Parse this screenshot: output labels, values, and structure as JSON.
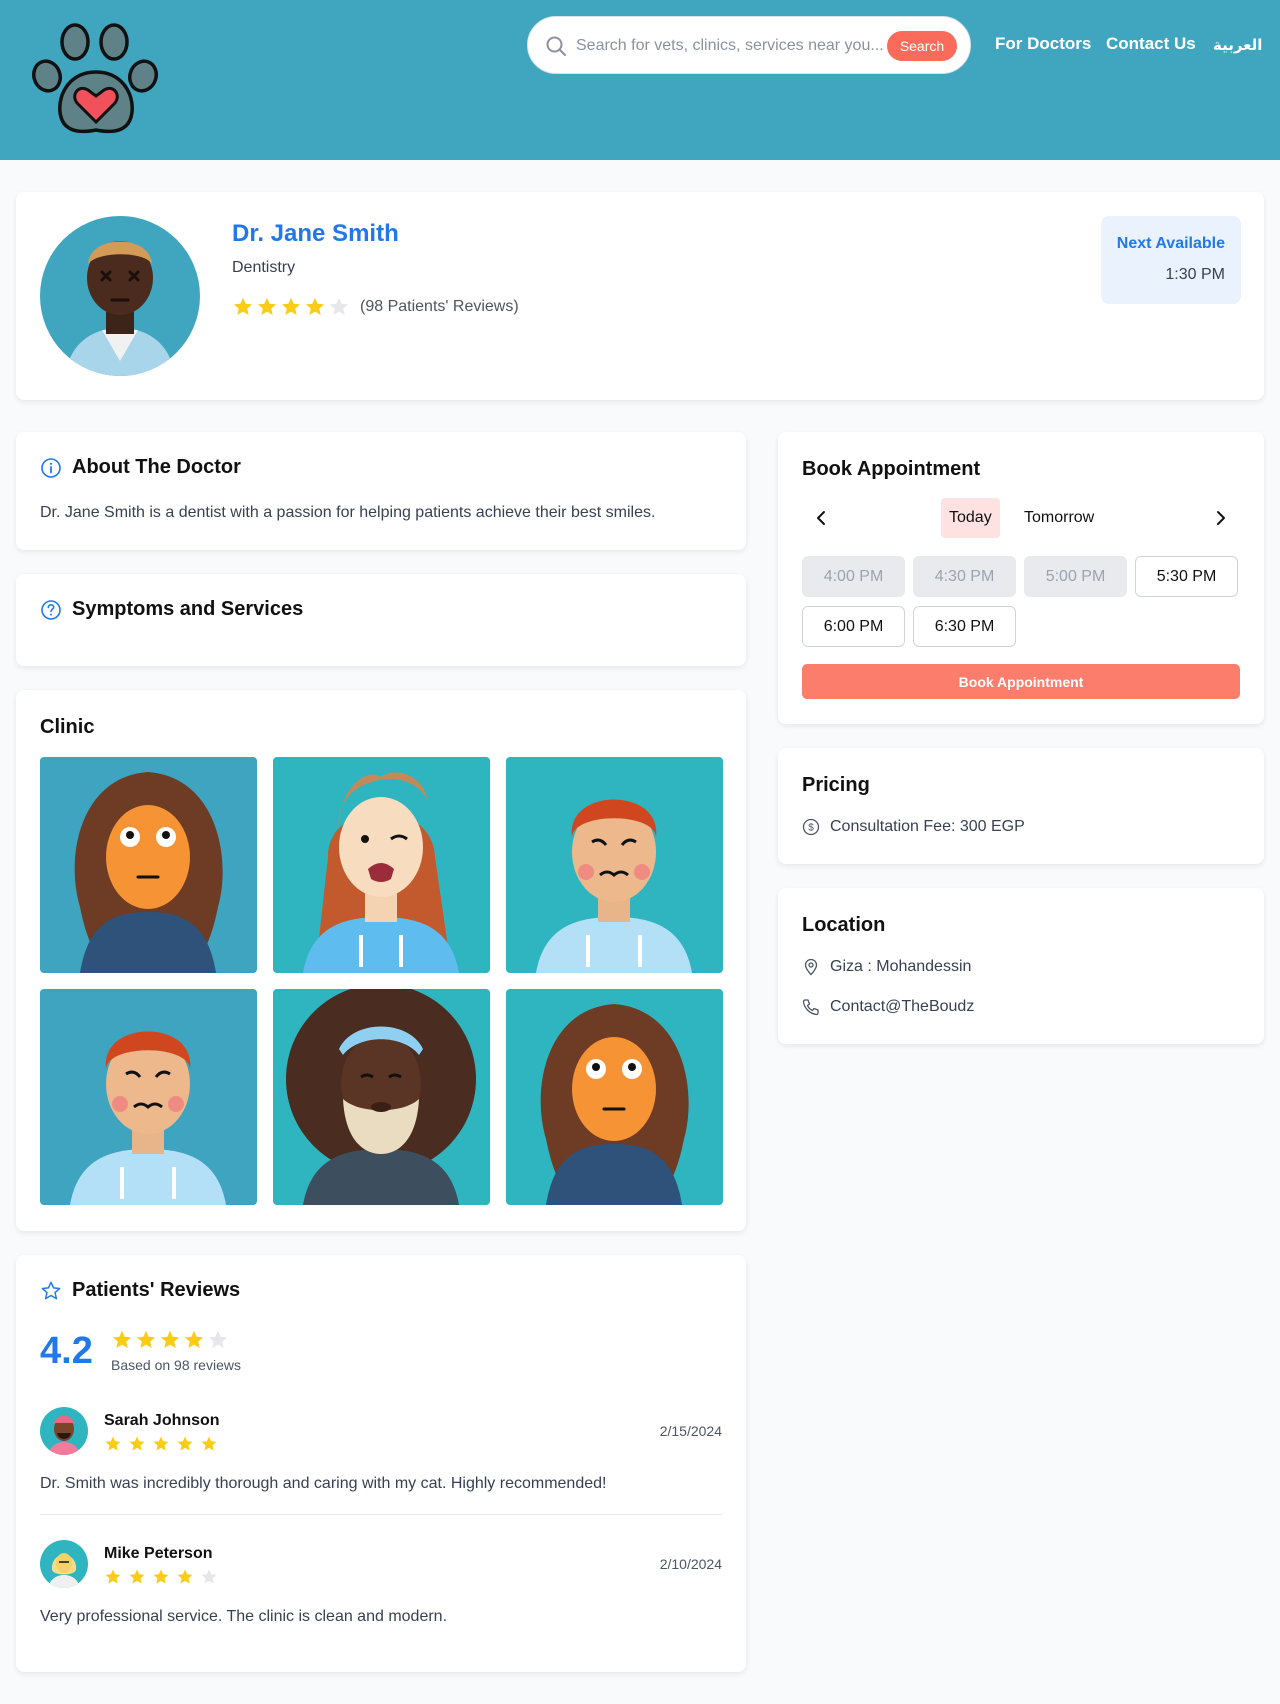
{
  "header": {
    "search_placeholder": "Search for vets, clinics, services near you...",
    "search_button": "Search",
    "nav": [
      "For Doctors",
      "Contact Us",
      "العربية"
    ]
  },
  "doctor": {
    "name": "Dr. Jane Smith",
    "specialty": "Dentistry",
    "rating_stars": 4,
    "reviews_label": "(98 Patients' Reviews)",
    "next_available_label": "Next Available",
    "next_available_time": "1:30 PM"
  },
  "about": {
    "title": "About The Doctor",
    "text": "Dr. Jane Smith is a dentist with a passion for helping patients achieve their best smiles."
  },
  "symptoms": {
    "title": "Symptoms and Services"
  },
  "clinic": {
    "title": "Clinic",
    "image_count": 6
  },
  "reviews": {
    "title": "Patients' Reviews",
    "average": "4.2",
    "average_stars": 4,
    "based_on": "Based on 98 reviews",
    "items": [
      {
        "name": "Sarah Johnson",
        "stars": 5,
        "date": "2/15/2024",
        "text": "Dr. Smith was incredibly thorough and caring with my cat. Highly recommended!"
      },
      {
        "name": "Mike Peterson",
        "stars": 4,
        "date": "2/10/2024",
        "text": "Very professional service. The clinic is clean and modern."
      }
    ]
  },
  "booking": {
    "title": "Book Appointment",
    "days": [
      "Today",
      "Tomorrow"
    ],
    "active_day": "Today",
    "slots": [
      {
        "time": "4:00 PM",
        "available": false
      },
      {
        "time": "4:30 PM",
        "available": false
      },
      {
        "time": "5:00 PM",
        "available": false
      },
      {
        "time": "5:30 PM",
        "available": true
      },
      {
        "time": "6:00 PM",
        "available": true
      },
      {
        "time": "6:30 PM",
        "available": true
      }
    ],
    "button": "Book Appointment"
  },
  "pricing": {
    "title": "Pricing",
    "fee": "Consultation Fee: 300 EGP"
  },
  "location": {
    "title": "Location",
    "address": "Giza : Mohandessin",
    "contact": "Contact@TheBoudz"
  },
  "colors": {
    "header": "#40a6c0",
    "accent": "#2178e8",
    "cta": "#fd7d6d",
    "star": "#facc15"
  }
}
